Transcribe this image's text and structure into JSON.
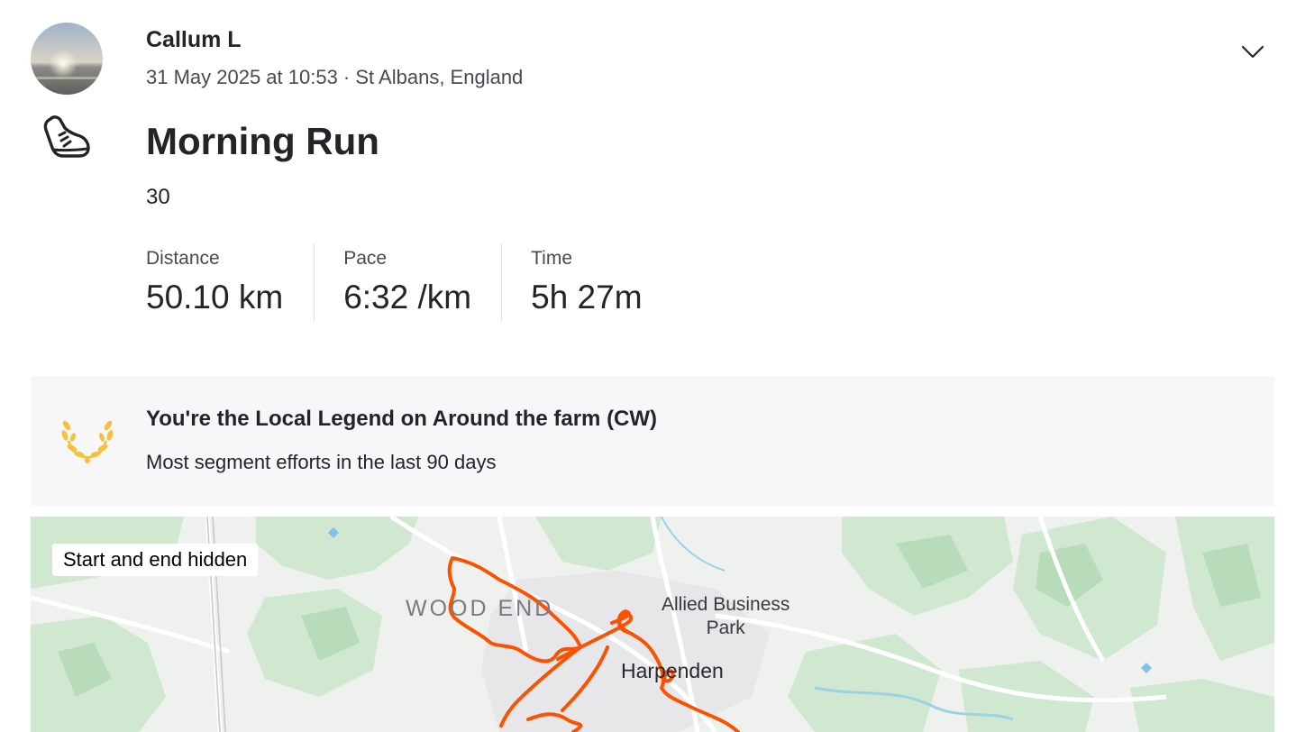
{
  "athlete": {
    "name": "Callum L",
    "meta": "31 May 2025 at 10:53 · St Albans, England"
  },
  "activity": {
    "title": "Morning Run",
    "description": "30",
    "sport_icon": "running-shoe-icon"
  },
  "stats": [
    {
      "label": "Distance",
      "value": "50.10 km"
    },
    {
      "label": "Pace",
      "value": "6:32 /km"
    },
    {
      "label": "Time",
      "value": "5h 27m"
    }
  ],
  "legend": {
    "title": "You're the Local Legend on Around the farm (CW)",
    "subtitle": "Most segment efforts in the last 90 days",
    "icon": "laurel-wreath-icon",
    "color": "#f5c33b"
  },
  "map": {
    "badge": "Start and end hidden",
    "labels": {
      "wood_end": "WOOD END",
      "allied_line1": "Allied Business",
      "allied_line2": "Park",
      "harpenden": "Harpenden"
    },
    "route_color": "#fc5200"
  },
  "icons": {
    "menu": "chevron-down-icon"
  }
}
